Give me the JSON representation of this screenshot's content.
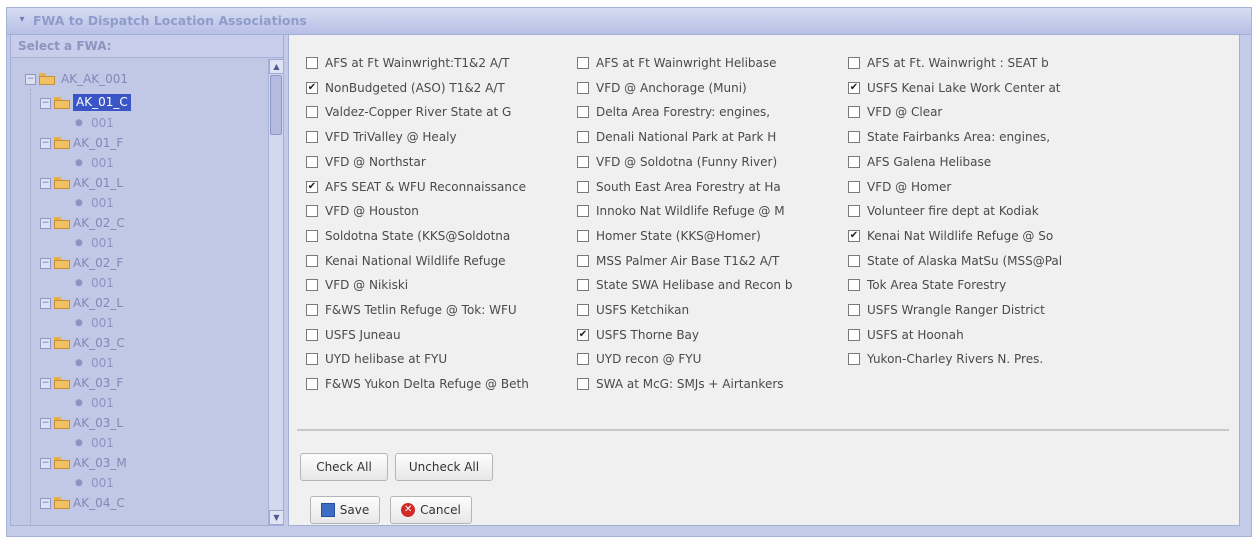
{
  "panel": {
    "title": "FWA to Dispatch Location Associations"
  },
  "tree": {
    "title": "Select a FWA:",
    "root": "AK_AK_001",
    "nodes": [
      {
        "label": "AK_01_C",
        "child": "001",
        "selected": true
      },
      {
        "label": "AK_01_F",
        "child": "001"
      },
      {
        "label": "AK_01_L",
        "child": "001"
      },
      {
        "label": "AK_02_C",
        "child": "001"
      },
      {
        "label": "AK_02_F",
        "child": "001"
      },
      {
        "label": "AK_02_L",
        "child": "001"
      },
      {
        "label": "AK_03_C",
        "child": "001"
      },
      {
        "label": "AK_03_F",
        "child": "001"
      },
      {
        "label": "AK_03_L",
        "child": "001"
      },
      {
        "label": "AK_03_M",
        "child": "001"
      },
      {
        "label": "AK_04_C",
        "child": ""
      }
    ]
  },
  "checkboxes": {
    "col1": [
      {
        "label": "AFS at Ft Wainwright:T1&2 A/T",
        "checked": false
      },
      {
        "label": "NonBudgeted (ASO) T1&2 A/T",
        "checked": true
      },
      {
        "label": "Valdez-Copper River State at G",
        "checked": false
      },
      {
        "label": "VFD TriValley @ Healy",
        "checked": false
      },
      {
        "label": "VFD @ Northstar",
        "checked": false
      },
      {
        "label": "AFS SEAT & WFU Reconnaissance",
        "checked": true
      },
      {
        "label": "VFD @ Houston",
        "checked": false
      },
      {
        "label": "Soldotna State (KKS@Soldotna",
        "checked": false
      },
      {
        "label": "Kenai National Wildlife Refuge",
        "checked": false
      },
      {
        "label": "VFD @ Nikiski",
        "checked": false
      },
      {
        "label": "F&WS Tetlin Refuge @ Tok: WFU",
        "checked": false
      },
      {
        "label": "USFS Juneau",
        "checked": false
      },
      {
        "label": "UYD helibase at FYU",
        "checked": false
      },
      {
        "label": "F&WS Yukon Delta Refuge @ Beth",
        "checked": false
      }
    ],
    "col2": [
      {
        "label": "AFS at Ft Wainwright Helibase",
        "checked": false
      },
      {
        "label": "VFD @ Anchorage (Muni)",
        "checked": false
      },
      {
        "label": "Delta Area Forestry: engines,",
        "checked": false
      },
      {
        "label": "Denali National Park at Park H",
        "checked": false
      },
      {
        "label": "VFD @ Soldotna (Funny River)",
        "checked": false
      },
      {
        "label": "South East Area Forestry at Ha",
        "checked": false
      },
      {
        "label": "Innoko Nat Wildlife Refuge @ M",
        "checked": false
      },
      {
        "label": "Homer State (KKS@Homer)",
        "checked": false
      },
      {
        "label": "MSS Palmer Air Base T1&2 A/T",
        "checked": false
      },
      {
        "label": "State SWA Helibase and Recon b",
        "checked": false
      },
      {
        "label": "USFS Ketchikan",
        "checked": false
      },
      {
        "label": "USFS Thorne Bay",
        "checked": true
      },
      {
        "label": "UYD recon @ FYU",
        "checked": false
      },
      {
        "label": "SWA at McG: SMJs + Airtankers",
        "checked": false
      }
    ],
    "col3": [
      {
        "label": "AFS at Ft. Wainwright : SEAT b",
        "checked": false
      },
      {
        "label": "USFS Kenai Lake Work Center at",
        "checked": true
      },
      {
        "label": "VFD @ Clear",
        "checked": false
      },
      {
        "label": "State Fairbanks Area: engines,",
        "checked": false
      },
      {
        "label": "AFS Galena Helibase",
        "checked": false
      },
      {
        "label": "VFD @ Homer",
        "checked": false
      },
      {
        "label": "Volunteer fire dept at Kodiak",
        "checked": false
      },
      {
        "label": "Kenai Nat Wildlife Refuge @ So",
        "checked": true
      },
      {
        "label": "State of Alaska MatSu (MSS@Pal",
        "checked": false
      },
      {
        "label": "Tok Area State Forestry",
        "checked": false
      },
      {
        "label": "USFS Wrangle Ranger District",
        "checked": false
      },
      {
        "label": "USFS at Hoonah",
        "checked": false
      },
      {
        "label": "Yukon-Charley Rivers N. Pres.",
        "checked": false
      }
    ]
  },
  "buttons": {
    "check_all": "Check All",
    "uncheck_all": "Uncheck All",
    "save": "Save",
    "cancel": "Cancel"
  }
}
